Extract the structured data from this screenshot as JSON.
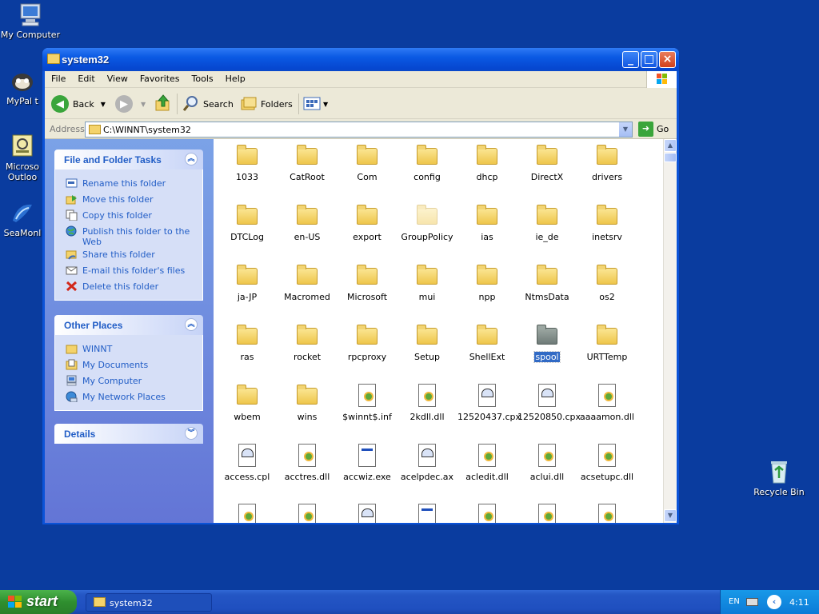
{
  "desktop": {
    "icons": [
      {
        "label": "My Computer",
        "icon": "my-computer-icon"
      },
      {
        "label": "MyPal t",
        "icon": "mypal-icon"
      },
      {
        "label": "Microso",
        "label2": "Outloo",
        "icon": "outlook-icon"
      },
      {
        "label": "SeaMonl",
        "icon": "seamonkey-icon"
      },
      {
        "label": "Recycle Bin",
        "icon": "recycle-bin-icon"
      }
    ]
  },
  "window": {
    "title": "system32",
    "menu": [
      "File",
      "Edit",
      "View",
      "Favorites",
      "Tools",
      "Help"
    ],
    "toolbar": {
      "back": "Back",
      "search": "Search",
      "folders": "Folders"
    },
    "address": {
      "label": "Address",
      "value": "C:\\WINNT\\system32",
      "go": "Go"
    }
  },
  "tasks_panel": {
    "title": "File and Folder Tasks",
    "items": [
      "Rename this folder",
      "Move this folder",
      "Copy this folder",
      "Publish this folder to the Web",
      "Share this folder",
      "E-mail this folder's files",
      "Delete this folder"
    ]
  },
  "places_panel": {
    "title": "Other Places",
    "items": [
      "WINNT",
      "My Documents",
      "My Computer",
      "My Network Places"
    ]
  },
  "details_panel": {
    "title": "Details"
  },
  "files": [
    {
      "name": "1033",
      "type": "folder"
    },
    {
      "name": "CatRoot",
      "type": "folder"
    },
    {
      "name": "Com",
      "type": "folder"
    },
    {
      "name": "config",
      "type": "folder"
    },
    {
      "name": "dhcp",
      "type": "folder"
    },
    {
      "name": "DirectX",
      "type": "folder"
    },
    {
      "name": "drivers",
      "type": "folder"
    },
    {
      "name": "DTCLog",
      "type": "folder"
    },
    {
      "name": "en-US",
      "type": "folder"
    },
    {
      "name": "export",
      "type": "folder"
    },
    {
      "name": "GroupPolicy",
      "type": "folder-hidden"
    },
    {
      "name": "ias",
      "type": "folder"
    },
    {
      "name": "ie_de",
      "type": "folder"
    },
    {
      "name": "inetsrv",
      "type": "folder"
    },
    {
      "name": "ja-JP",
      "type": "folder"
    },
    {
      "name": "Macromed",
      "type": "folder"
    },
    {
      "name": "Microsoft",
      "type": "folder"
    },
    {
      "name": "mui",
      "type": "folder"
    },
    {
      "name": "npp",
      "type": "folder"
    },
    {
      "name": "NtmsData",
      "type": "folder"
    },
    {
      "name": "os2",
      "type": "folder"
    },
    {
      "name": "ras",
      "type": "folder"
    },
    {
      "name": "rocket",
      "type": "folder"
    },
    {
      "name": "rpcproxy",
      "type": "folder"
    },
    {
      "name": "Setup",
      "type": "folder"
    },
    {
      "name": "ShellExt",
      "type": "folder"
    },
    {
      "name": "spool",
      "type": "folder-selected"
    },
    {
      "name": "URTTemp",
      "type": "folder"
    },
    {
      "name": "wbem",
      "type": "folder"
    },
    {
      "name": "wins",
      "type": "folder"
    },
    {
      "name": "$winnt$.inf",
      "type": "inf"
    },
    {
      "name": "2kdll.dll",
      "type": "dll"
    },
    {
      "name": "12520437.cpx",
      "type": "cpx"
    },
    {
      "name": "12520850.cpx",
      "type": "cpx"
    },
    {
      "name": "aaaamon.dll",
      "type": "dll"
    },
    {
      "name": "access.cpl",
      "type": "cpl"
    },
    {
      "name": "acctres.dll",
      "type": "dll"
    },
    {
      "name": "accwiz.exe",
      "type": "exe"
    },
    {
      "name": "acelpdec.ax",
      "type": "cpx"
    },
    {
      "name": "acledit.dll",
      "type": "dll"
    },
    {
      "name": "aclui.dll",
      "type": "dll"
    },
    {
      "name": "acsetupc.dll",
      "type": "dll"
    },
    {
      "name": "",
      "type": "dll"
    },
    {
      "name": "",
      "type": "dll"
    },
    {
      "name": "",
      "type": "cpx"
    },
    {
      "name": "",
      "type": "exe"
    },
    {
      "name": "",
      "type": "dll"
    },
    {
      "name": "",
      "type": "dll"
    },
    {
      "name": "",
      "type": "dll"
    }
  ],
  "taskbar": {
    "start": "start",
    "task": "system32",
    "tray": {
      "lang": "EN",
      "clock": "4:11"
    }
  }
}
